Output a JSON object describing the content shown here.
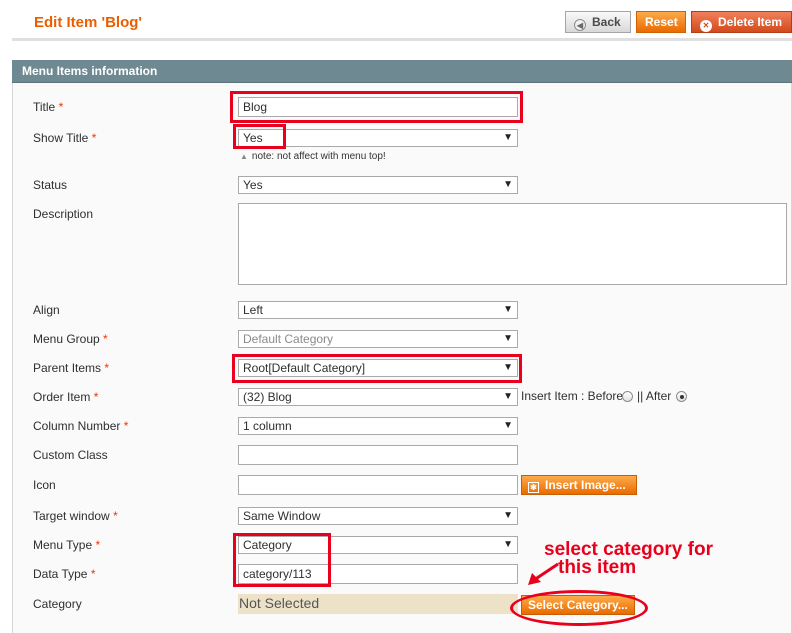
{
  "header": {
    "title": "Edit Item 'Blog'",
    "buttons": {
      "back": "Back",
      "reset": "Reset",
      "delete": "Delete Item"
    }
  },
  "section": {
    "title": "Menu Items information"
  },
  "form": {
    "title": {
      "label": "Title",
      "value": "Blog"
    },
    "show_title": {
      "label": "Show Title",
      "value": "Yes",
      "note": "note: not affect with menu top!"
    },
    "status": {
      "label": "Status",
      "value": "Yes"
    },
    "description": {
      "label": "Description",
      "value": ""
    },
    "align": {
      "label": "Align",
      "value": "Left"
    },
    "menu_group": {
      "label": "Menu Group",
      "value": "Default Category"
    },
    "parent_items": {
      "label": "Parent Items",
      "value": "Root[Default Category]"
    },
    "order_item": {
      "label": "Order Item",
      "value": "(32) Blog",
      "insert_label": "Insert Item : Before",
      "separator": "|| After",
      "selected": "After"
    },
    "column_number": {
      "label": "Column Number",
      "value": "1 column"
    },
    "custom_class": {
      "label": "Custom Class",
      "value": ""
    },
    "icon": {
      "label": "Icon",
      "value": "",
      "button": "Insert Image..."
    },
    "target_window": {
      "label": "Target window",
      "value": "Same Window"
    },
    "menu_type": {
      "label": "Menu Type",
      "value": "Category"
    },
    "data_type": {
      "label": "Data Type",
      "value": "category/113"
    },
    "category": {
      "label": "Category",
      "value": "Not Selected",
      "button": "Select Category..."
    }
  },
  "annotation": {
    "line1": "select category for",
    "line2": "this item"
  },
  "colors": {
    "title_orange": "#eb5e00",
    "highlight_red": "#e8001c",
    "section_header": "#6f8992"
  },
  "icons": [
    "back-arrow-icon",
    "delete-icon",
    "dropdown-caret-icon",
    "insert-image-icon",
    "note-arrow-icon",
    "annotation-arrow-icon"
  ]
}
